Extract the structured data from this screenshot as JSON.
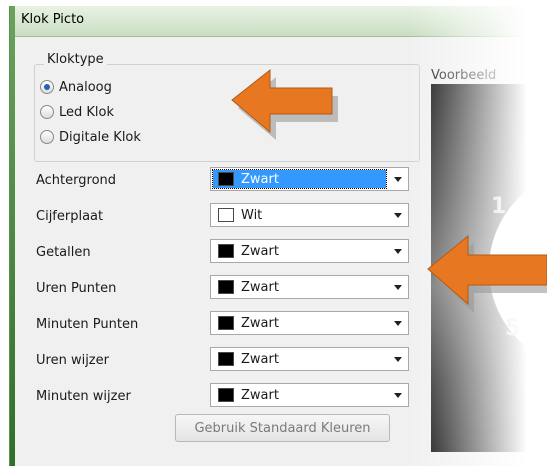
{
  "window": {
    "title": "Klok Picto"
  },
  "kloktype": {
    "legend": "Kloktype",
    "options": [
      {
        "label": "Analoog",
        "checked": true
      },
      {
        "label": "Led Klok",
        "checked": false
      },
      {
        "label": "Digitale Klok",
        "checked": false
      }
    ]
  },
  "colors": [
    {
      "label": "Achtergrond",
      "value": "Zwart",
      "swatch": "#000000",
      "selected": true
    },
    {
      "label": "Cijferplaat",
      "value": "Wit",
      "swatch": "#ffffff",
      "selected": false
    },
    {
      "label": "Getallen",
      "value": "Zwart",
      "swatch": "#000000",
      "selected": false
    },
    {
      "label": "Uren Punten",
      "value": "Zwart",
      "swatch": "#000000",
      "selected": false
    },
    {
      "label": "Minuten Punten",
      "value": "Zwart",
      "swatch": "#000000",
      "selected": false
    },
    {
      "label": "Uren wijzer",
      "value": "Zwart",
      "swatch": "#000000",
      "selected": false
    },
    {
      "label": "Minuten wijzer",
      "value": "Zwart",
      "swatch": "#000000",
      "selected": false
    }
  ],
  "buttons": {
    "standaard": "Gebruik Standaard Kleuren"
  },
  "preview": {
    "label": "Voorbeeld",
    "digit_top": "1",
    "digit_bottom": "5"
  },
  "accent": {
    "arrow": "#e87722"
  }
}
